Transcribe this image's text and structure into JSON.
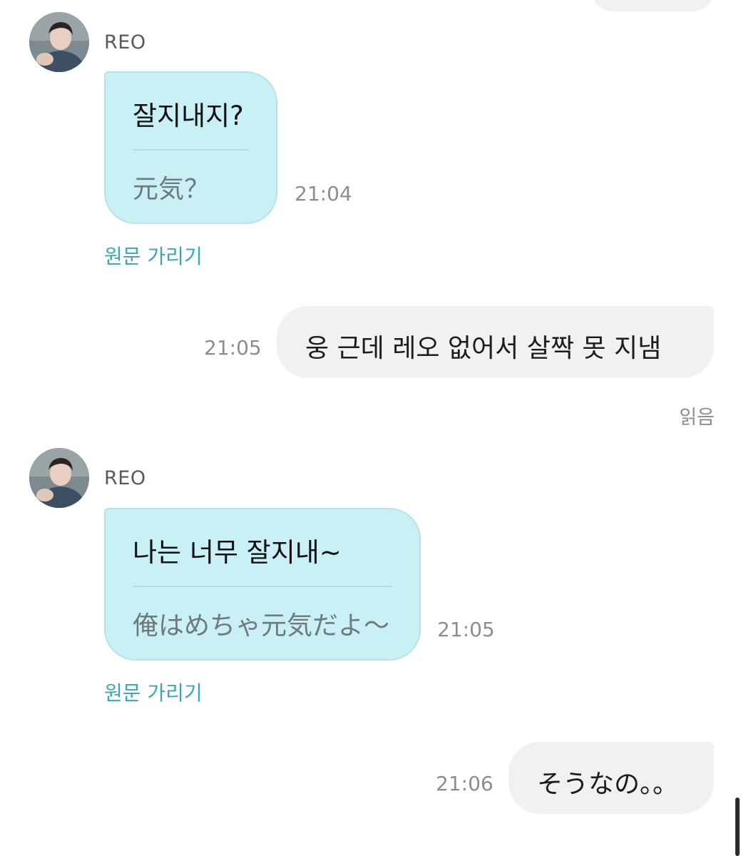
{
  "chat": {
    "sender_name": "REO",
    "hide_original_label": "원문 가리기",
    "read_label": "읽음",
    "messages": [
      {
        "direction": "incoming",
        "original": "잘지내지?",
        "translation": "元気？",
        "time": "21:04"
      },
      {
        "direction": "outgoing",
        "text": "웅 근데 레오 없어서 살짝 못 지냄",
        "time": "21:05"
      },
      {
        "direction": "incoming",
        "original": "나는 너무 잘지내~",
        "translation": "俺はめちゃ元気だよ～",
        "time": "21:05"
      },
      {
        "direction": "outgoing",
        "text": "そうなの。。",
        "time": "21:06"
      }
    ]
  },
  "icons": {
    "avatar": "profile-photo"
  },
  "colors": {
    "incoming_bubble": "#c9f0f4",
    "outgoing_bubble": "#f1f1f4",
    "link": "#34a9b5",
    "timestamp": "#8a8d91"
  }
}
